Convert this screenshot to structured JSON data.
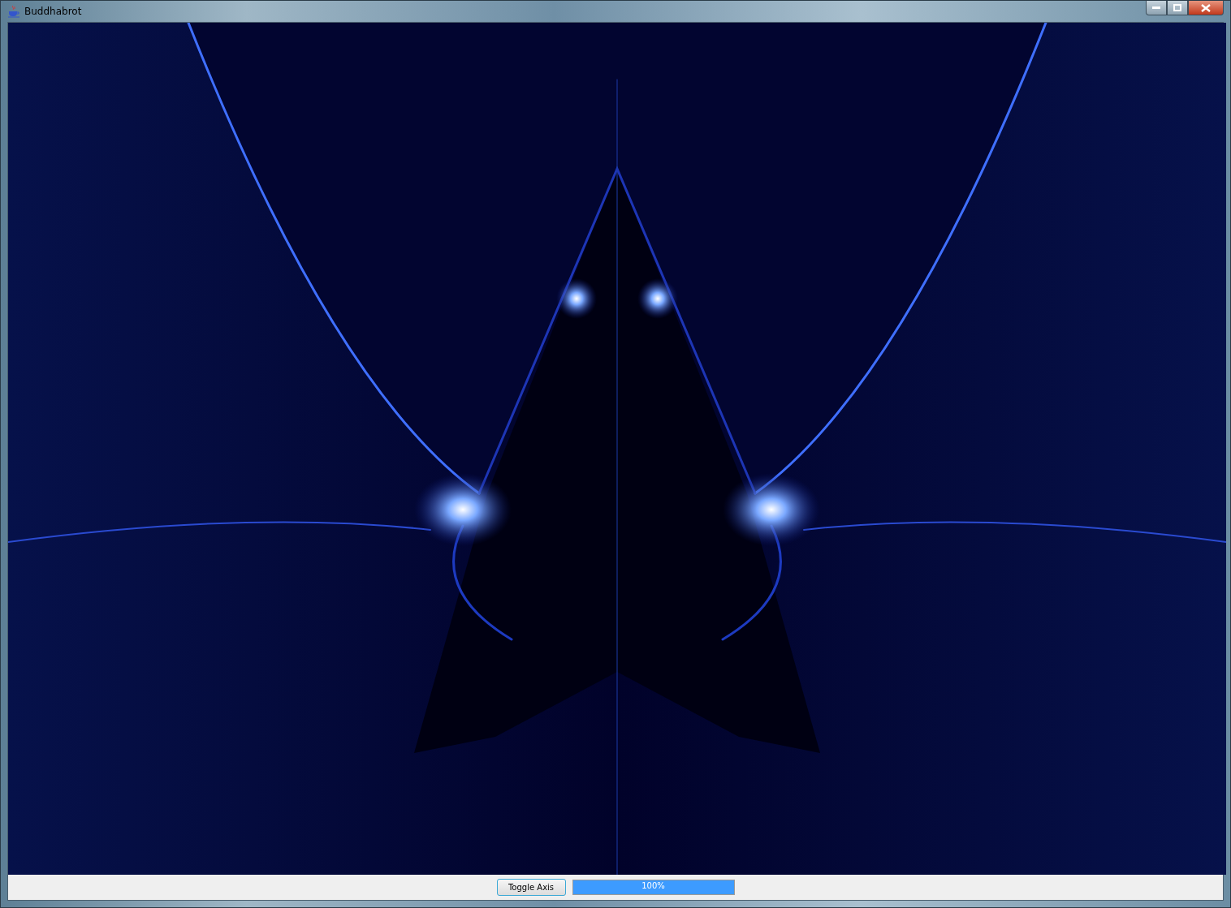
{
  "window": {
    "title": "Buddhabrot"
  },
  "controls": {
    "button": {
      "label": "Toggle Axis"
    },
    "progress": {
      "level": 1,
      "reading": "100%"
    }
  }
}
